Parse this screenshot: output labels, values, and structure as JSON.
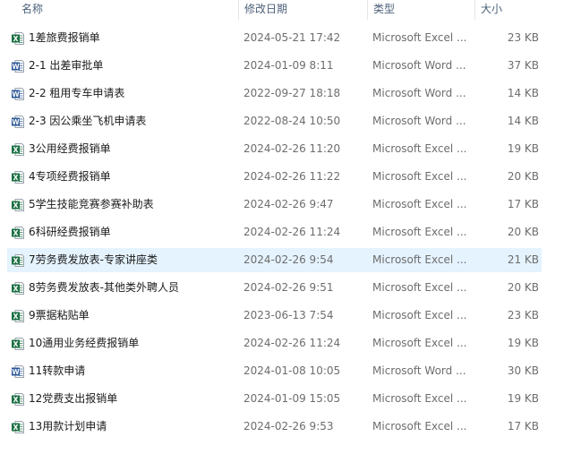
{
  "header": {
    "name": "名称",
    "date": "修改日期",
    "type": "类型",
    "size": "大小"
  },
  "colors": {
    "excel": "#1d7044",
    "word": "#2b5797",
    "selected": "#e5f3ff"
  },
  "files": [
    {
      "name": "1差旅费报销单",
      "date": "2024-05-21 17:42",
      "type": "Microsoft Excel ...",
      "size": "23 KB",
      "icon": "excel-file-icon"
    },
    {
      "name": "2-1 出差审批单",
      "date": "2024-01-09 8:11",
      "type": "Microsoft Word ...",
      "size": "37 KB",
      "icon": "word-file-icon"
    },
    {
      "name": "2-2 租用专车申请表",
      "date": "2022-09-27 18:18",
      "type": "Microsoft Word ...",
      "size": "14 KB",
      "icon": "word-file-icon"
    },
    {
      "name": "2-3 因公乘坐飞机申请表",
      "date": "2022-08-24 10:50",
      "type": "Microsoft Word ...",
      "size": "14 KB",
      "icon": "word-file-icon"
    },
    {
      "name": "3公用经费报销单",
      "date": "2024-02-26 11:20",
      "type": "Microsoft Excel ...",
      "size": "19 KB",
      "icon": "excel-file-icon"
    },
    {
      "name": "4专项经费报销单",
      "date": "2024-02-26 11:22",
      "type": "Microsoft Excel ...",
      "size": "20 KB",
      "icon": "excel-file-icon"
    },
    {
      "name": "5学生技能竞赛参赛补助表",
      "date": "2024-02-26 9:47",
      "type": "Microsoft Excel ...",
      "size": "17 KB",
      "icon": "excel-file-icon"
    },
    {
      "name": "6科研经费报销单",
      "date": "2024-02-26 11:24",
      "type": "Microsoft Excel ...",
      "size": "20 KB",
      "icon": "excel-file-icon"
    },
    {
      "name": "7劳务费发放表-专家讲座类",
      "date": "2024-02-26 9:54",
      "type": "Microsoft Excel ...",
      "size": "21 KB",
      "icon": "excel-file-icon",
      "selected": true
    },
    {
      "name": "8劳务费发放表-其他类外聘人员",
      "date": "2024-02-26 9:51",
      "type": "Microsoft Excel ...",
      "size": "20 KB",
      "icon": "excel-file-icon"
    },
    {
      "name": "9票据粘贴单",
      "date": "2023-06-13 7:54",
      "type": "Microsoft Excel ...",
      "size": "23 KB",
      "icon": "excel-file-icon"
    },
    {
      "name": "10通用业务经费报销单",
      "date": "2024-02-26 11:24",
      "type": "Microsoft Excel ...",
      "size": "19 KB",
      "icon": "excel-file-icon"
    },
    {
      "name": "11转款申请",
      "date": "2024-01-08 10:05",
      "type": "Microsoft Word ...",
      "size": "30 KB",
      "icon": "word-file-icon"
    },
    {
      "name": "12党费支出报销单",
      "date": "2024-01-09 15:05",
      "type": "Microsoft Excel ...",
      "size": "19 KB",
      "icon": "excel-file-icon"
    },
    {
      "name": "13用款计划申请",
      "date": "2024-02-26 9:53",
      "type": "Microsoft Excel ...",
      "size": "17 KB",
      "icon": "excel-file-icon"
    }
  ]
}
